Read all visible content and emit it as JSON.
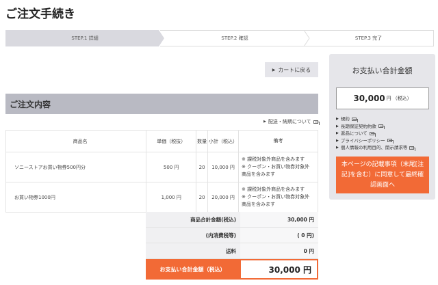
{
  "page": {
    "title": "ご注文手続き"
  },
  "steps": [
    {
      "label": "STEP.1 詳細",
      "active": true
    },
    {
      "label": "STEP.2 確認",
      "active": false
    },
    {
      "label": "STEP.3 完了",
      "active": false
    }
  ],
  "back_button": {
    "label": "カートに戻る",
    "icon": "triangle-right-icon"
  },
  "order": {
    "heading": "ご注文内容",
    "delivery_link": "配送・納期について",
    "columns": [
      "商品名",
      "単価（税抜）",
      "数量",
      "小計（税込）",
      "備考"
    ],
    "rows": [
      {
        "name": "ソニーストアお買い物券500円分",
        "price": "500 円",
        "qty": "20",
        "subtotal": "10,000 円",
        "notes": [
          "※ 課税対象外商品を含みます",
          "※ クーポン・お買い物券対象外",
          "商品を含みます"
        ]
      },
      {
        "name": "お買い物券1000円",
        "price": "1,000 円",
        "qty": "20",
        "subtotal": "20,000 円",
        "notes": [
          "※ 課税対象外商品を含みます",
          "※ クーポン・お買い物券対象外",
          "商品を含みます"
        ]
      }
    ],
    "totals": [
      {
        "label": "商品合計金額(税込)",
        "value": "30,000 円"
      },
      {
        "label": "(内消費税等)",
        "value": "( 0 円)"
      },
      {
        "label": "送料",
        "value": "0 円"
      }
    ],
    "grand_total": {
      "label": "お支払い合計金額（税込）",
      "value": "30,000 円"
    }
  },
  "summary_panel": {
    "title": "お支払い合計金額",
    "amount": "30,000",
    "unit": "円",
    "tax_note": "（税込）",
    "links": [
      "規約",
      "長期保証契約約款",
      "返品について",
      "プライバシーポリシー",
      "個人情報の利用目的、開示請求等"
    ],
    "confirm_button": "本ページの記載事項（末尾[注記]を含む）に同意して最終確認画面へ"
  },
  "colors": {
    "accent": "#f26a36",
    "step_active": "#d9d9df",
    "section_head": "#b9bac3",
    "panel_bg": "#e6e6ea"
  }
}
